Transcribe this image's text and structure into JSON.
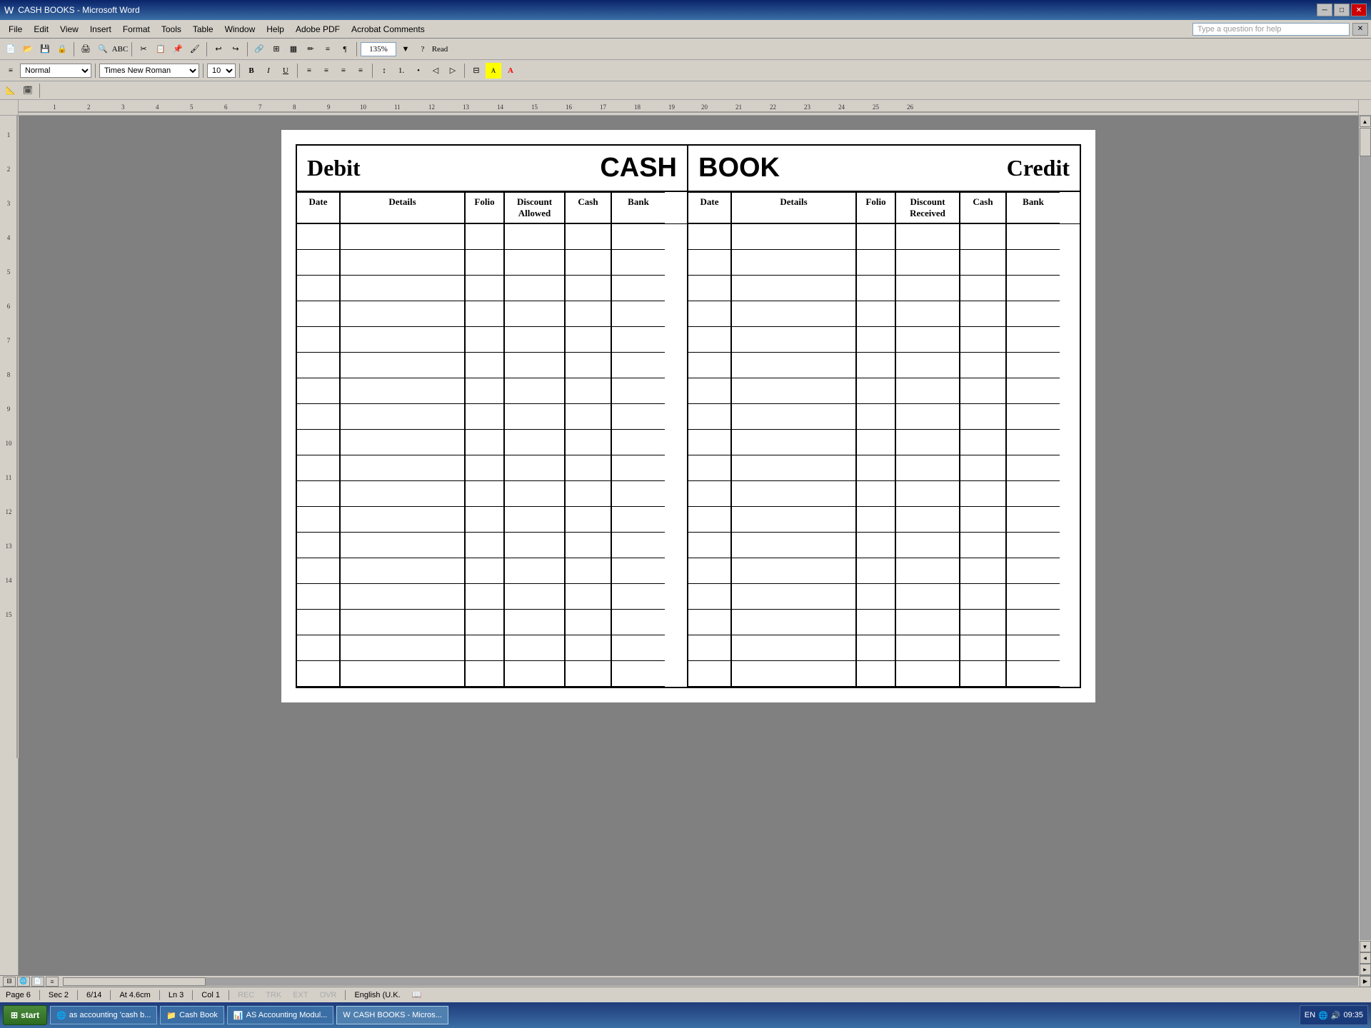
{
  "window": {
    "title": "CASH BOOKS - Microsoft Word",
    "icon": "word-icon"
  },
  "titlebar": {
    "title": "CASH BOOKS - Microsoft Word",
    "minimize_label": "─",
    "maximize_label": "□",
    "close_label": "✕"
  },
  "menubar": {
    "items": [
      "File",
      "Edit",
      "View",
      "Insert",
      "Format",
      "Tools",
      "Table",
      "Window",
      "Help",
      "Adobe PDF",
      "Acrobat Comments"
    ],
    "help_placeholder": "Type a question for help"
  },
  "toolbar1": {
    "zoom": "135%",
    "read_label": "Read"
  },
  "toolbar2": {
    "style": "Normal",
    "font": "Times New Roman",
    "size": "10"
  },
  "cashbook": {
    "debit_label": "Debit",
    "cash_label": "CASH",
    "book_label": "BOOK",
    "credit_label": "Credit",
    "debit_headers": [
      "Date",
      "Details",
      "Folio",
      "Discount Allowed",
      "Cash",
      "Bank"
    ],
    "credit_headers": [
      "Date",
      "Details",
      "Folio",
      "Discount Received",
      "Cash",
      "Bank"
    ],
    "row_count": 18
  },
  "statusbar": {
    "page": "Page 6",
    "sec": "Sec 2",
    "page_of": "6/14",
    "at": "At 4.6cm",
    "ln": "Ln 3",
    "col": "Col 1",
    "rec": "REC",
    "trk": "TRK",
    "ext": "EXT",
    "ovr": "OVR",
    "lang": "English (U.K."
  },
  "taskbar": {
    "start_label": "start",
    "items": [
      {
        "label": "as accounting 'cash b...",
        "active": false
      },
      {
        "label": "Cash Book",
        "active": false
      },
      {
        "label": "AS Accounting Modul...",
        "active": false
      },
      {
        "label": "CASH BOOKS - Micros...",
        "active": true
      }
    ],
    "tray_time": "09:35",
    "tray_lang": "EN"
  }
}
